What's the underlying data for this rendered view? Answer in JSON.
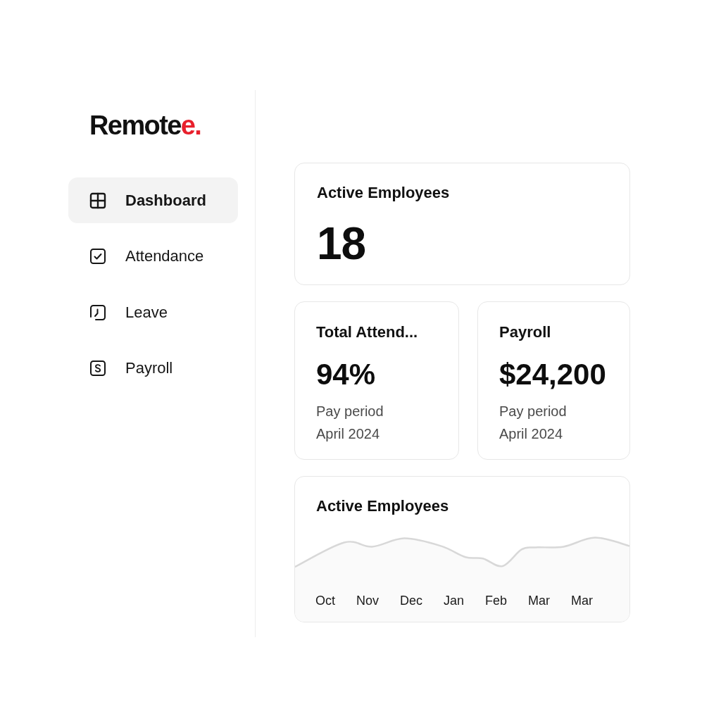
{
  "logo": {
    "text": "Remote",
    "accent": "e."
  },
  "nav": [
    {
      "label": "Dashboard",
      "selected": true
    },
    {
      "label": "Attendance",
      "selected": false
    },
    {
      "label": "Leave",
      "selected": false
    },
    {
      "label": "Payroll",
      "selected": false
    }
  ],
  "summary": {
    "title": "Active Employees",
    "value": "18"
  },
  "cards": [
    {
      "title": "Total Attend...",
      "value": "94%",
      "caption": [
        "Pay period",
        "April 2024"
      ]
    },
    {
      "title": "Payroll",
      "value": "$24,200",
      "caption": [
        "Pay period",
        "April 2024"
      ]
    }
  ],
  "trend": {
    "title": "Active Employees",
    "months": [
      "Oct",
      "Nov",
      "Dec",
      "Jan",
      "Feb",
      "Mar",
      "Mar"
    ]
  }
}
